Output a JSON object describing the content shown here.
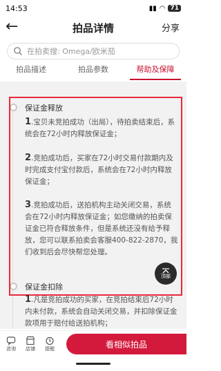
{
  "status": {
    "time": "14:53",
    "battery": "71"
  },
  "header": {
    "title": "拍品详情",
    "share": "分享"
  },
  "search": {
    "placeholder": "在拍卖搜: Omega/欧米茄"
  },
  "tabs": [
    {
      "label": "拍品描述",
      "active": false
    },
    {
      "label": "拍品参数",
      "active": false
    },
    {
      "label": "帮助及保障",
      "active": true
    }
  ],
  "sections": [
    {
      "title": "保证金释放",
      "items": [
        {
          "num": "1",
          "text": ".宝贝未竞拍成功（出局），待拍卖结束后，系统会在72小时内释放保证金；"
        },
        {
          "num": "2",
          "text": ".竞拍成功后，买家在72小时交易付款期内及时完成支付宝付款后，系统会在72小时内释放保证金；"
        },
        {
          "num": "3",
          "text": ".竞拍成功后，送拍机构主动关闭交易，系统会在72小时内释放保证金；如您缴纳的拍卖保证金已符合释放条件，但是系统还没有给予释放，您可以联系拍卖会客服400-822-2870，我们收到后会尽快帮您处理。"
        }
      ]
    },
    {
      "title": "保证金扣除",
      "items": [
        {
          "num": "1",
          "text": ".凡是竞拍成功的买家，在竞拍结束后72小时内未付款，系统会自动关闭交易，并扣除保证金款项用于赔付给送拍机构；"
        }
      ]
    }
  ],
  "back_to_top": "顶部",
  "bottom": {
    "items": [
      "咨询",
      "店铺",
      "提醒"
    ],
    "cta": "看相似拍品"
  },
  "colors": {
    "accent": "#d41a3c",
    "highlight": "#e8283a"
  }
}
